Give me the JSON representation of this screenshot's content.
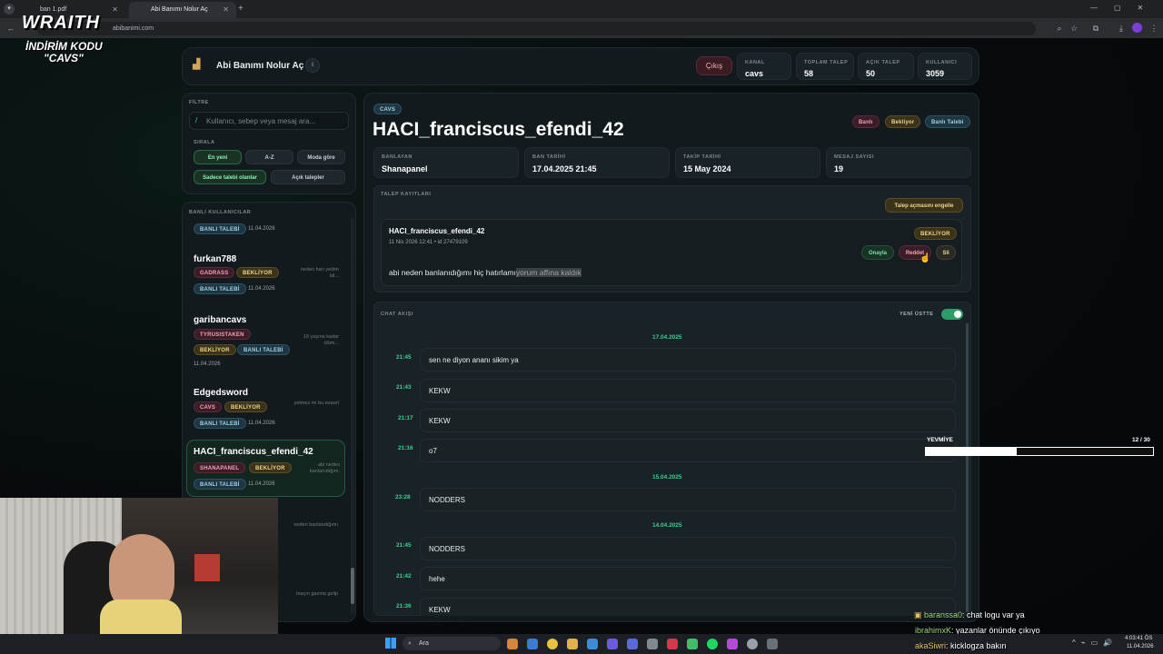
{
  "browser": {
    "tabs": [
      {
        "label": "ban 1.pdf",
        "active": false
      },
      {
        "label": "Abi Banımı Nolur Aç",
        "active": true
      }
    ],
    "url": "abibanimi.com"
  },
  "overlay": {
    "brand": "WRAITH",
    "promo_line1": "İNDİRİM KODU",
    "promo_line2": "\"CAVS\""
  },
  "header": {
    "title": "Abi Banımı Nolur Aç",
    "info": "i",
    "logout": "Çıkış",
    "stats": [
      {
        "label": "KANAL",
        "value": "cavs"
      },
      {
        "label": "TOPLAM TALEP",
        "value": "58"
      },
      {
        "label": "AÇIK TALEP",
        "value": "50"
      },
      {
        "label": "KULLANICI",
        "value": "3059"
      }
    ]
  },
  "filter": {
    "title": "FİLTRE",
    "search_placeholder": "Kullanıcı, sebep veya mesaj ara...",
    "sort_label": "SIRALA",
    "sort_options": [
      "En yeni",
      "A-Z",
      "Moda göre"
    ],
    "toggles": [
      "Sadece talebi olanlar",
      "Açık talepler"
    ]
  },
  "banned": {
    "title": "BANLI KULLANICILAR",
    "top_badge": "BANLI TALEBİ",
    "top_date": "11.04.2026",
    "users": [
      {
        "name": "furkan788",
        "tags": [
          "GADRASS",
          "BEKLİYOR"
        ],
        "badge": "BANLI TALEBİ",
        "date": "11.04.2026",
        "snippet": "neden ban yedim bil..."
      },
      {
        "name": "garibancavs",
        "tags": [
          "TYRUSISTAKEN",
          "BEKLİYOR",
          "BANLI TALEBİ"
        ],
        "badge": "",
        "date": "11.04.2026",
        "snippet": "18 yaşına kadar ölüm..."
      },
      {
        "name": "Edgedsword",
        "tags": [
          "CAVS",
          "BEKLİYOR"
        ],
        "badge": "BANLI TALEBİ",
        "date": "11.04.2026",
        "snippet": "yetmez mi bu esaret"
      },
      {
        "name": "HACI_franciscus_efendi_42",
        "tags": [
          "SHANAPANEL",
          "BEKLİYOR"
        ],
        "badge": "BANLI TALEBİ",
        "date": "11.04.2026",
        "snippet": "abi neden banlanıdığım."
      }
    ],
    "tail_snippets": [
      "neden banlandığımı",
      "maçın gazına gelip"
    ]
  },
  "detail": {
    "channel": "CAVS",
    "username": "HACI_franciscus_efendi_42",
    "status_pills": [
      "Banlı",
      "Bekliyor",
      "Banlı Talebi"
    ],
    "fields": [
      {
        "label": "BANLAYAN",
        "value": "Shanapanel"
      },
      {
        "label": "BAN TARİHİ",
        "value": "17.04.2025 21:45"
      },
      {
        "label": "TAKİP TARİHİ",
        "value": "15 May 2024"
      },
      {
        "label": "MESAJ SAYISI",
        "value": "19"
      }
    ],
    "requests_title": "TALEP KAYITLARI",
    "block_button": "Talep açmasını engelle",
    "request": {
      "user": "HACI_franciscus_efendi_42",
      "meta": "11 Nis 2026 12:41 • id 27479109",
      "status": "BEKLİYOR",
      "message_plain": "abi neden banlanıdığımı hiç hatırlamı",
      "message_selected": "yorum affına kaldık",
      "actions": [
        "Onayla",
        "Reddet",
        "Sil"
      ]
    },
    "chat": {
      "title": "CHAT AKIŞI",
      "toggle_label": "YENİ ÜSTTE",
      "toggle_on": true,
      "groups": [
        {
          "date": "17.04.2025",
          "messages": [
            {
              "time": "21:45",
              "text": "sen ne diyon ananı sikim ya"
            },
            {
              "time": "21:43",
              "text": "KEKW"
            },
            {
              "time": "21:17",
              "text": "KEKW"
            },
            {
              "time": "21:16",
              "text": "o7"
            }
          ]
        },
        {
          "date": "15.04.2025",
          "messages": [
            {
              "time": "23:28",
              "text": "NODDERS"
            }
          ]
        },
        {
          "date": "14.04.2025",
          "messages": [
            {
              "time": "21:45",
              "text": "NODDERS"
            },
            {
              "time": "21:42",
              "text": "hehe"
            },
            {
              "time": "21:36",
              "text": "KEKW"
            }
          ]
        }
      ]
    }
  },
  "stream": {
    "goal_label": "YEVMİYE",
    "goal_count": "12 / 30",
    "goal_progress": 0.4,
    "chat": [
      {
        "user": "baranssa0",
        "text": ": chat logu var ya",
        "color": "#9fd87a"
      },
      {
        "user": "ibrahimxK",
        "text": ": yazanlar önünde çıkıyo",
        "color": "#9fd87a"
      },
      {
        "user": "akaSiwri",
        "text": ": kicklogza bakın",
        "color": "#e6c36a"
      }
    ]
  },
  "taskbar": {
    "search": "Ara",
    "time": "4:03:41 ÖS",
    "date": "11.04.2026"
  }
}
